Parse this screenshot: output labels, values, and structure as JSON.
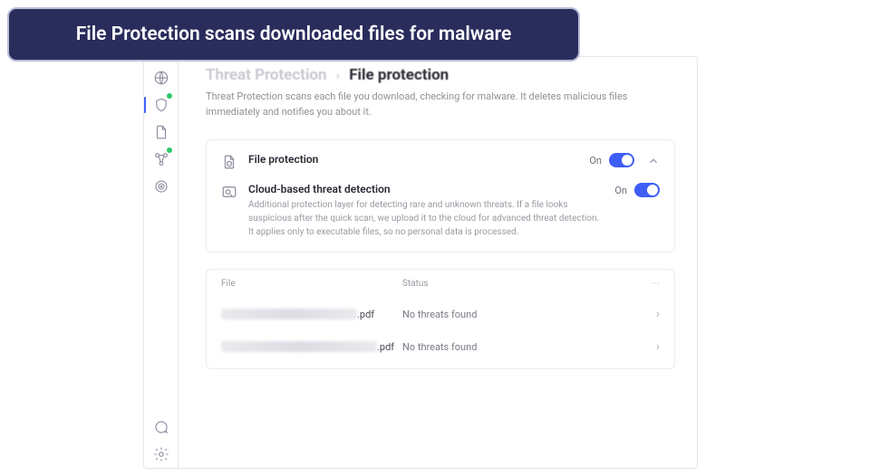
{
  "banner": {
    "text": "File Protection scans downloaded files for malware"
  },
  "breadcrumb": {
    "parent": "Threat Protection",
    "current": "File protection"
  },
  "subtitle": "Threat Protection scans each file you download, checking for malware. It deletes malicious files immediately and notifies you about it.",
  "settings": {
    "file_protection": {
      "title": "File protection",
      "state": "On"
    },
    "cloud": {
      "title": "Cloud-based threat detection",
      "desc": "Additional protection layer for detecting rare and unknown threats. If a file looks suspicious after the quick scan, we upload it to the cloud for advanced threat detection. It applies only to executable files, so no personal data is processed.",
      "state": "On"
    }
  },
  "table": {
    "headers": {
      "file": "File",
      "status": "Status"
    },
    "rows": [
      {
        "ext": ".pdf",
        "status": "No threats found"
      },
      {
        "ext": ".pdf",
        "status": "No threats found"
      }
    ]
  }
}
